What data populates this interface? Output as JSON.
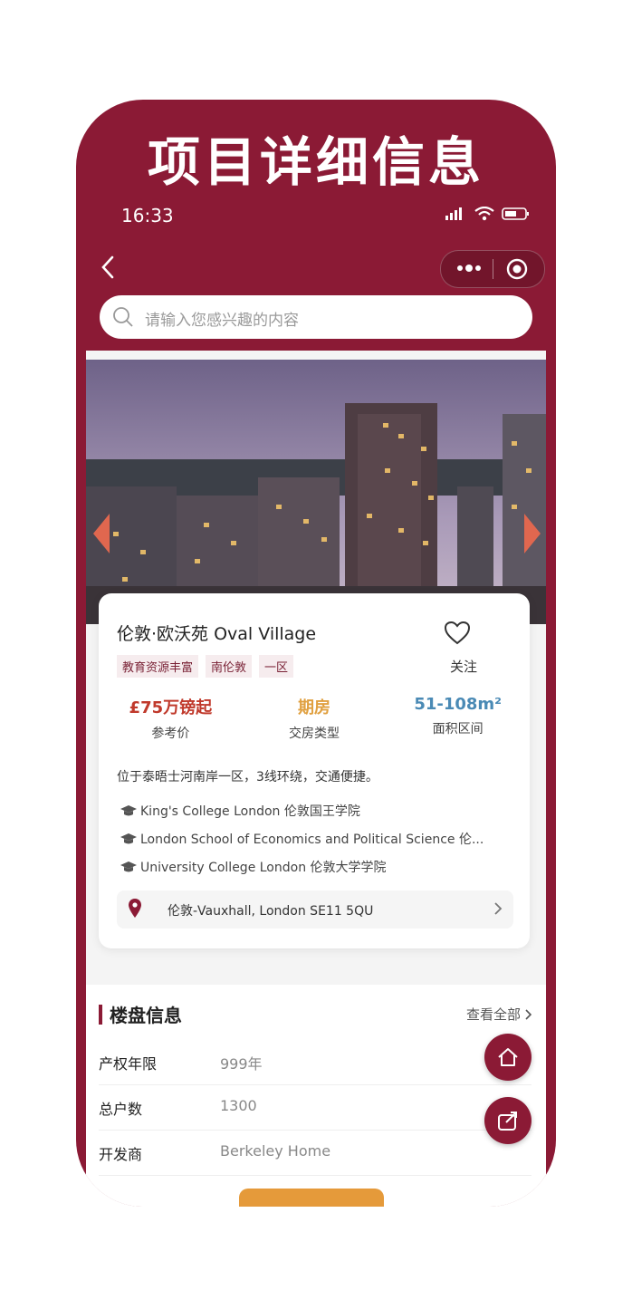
{
  "banner": {
    "title": "项目详细信息"
  },
  "status_bar": {
    "time": "16:33"
  },
  "search": {
    "placeholder": "请输入您感兴趣的内容"
  },
  "project": {
    "title": "伦敦·欧沃苑 Oval Village",
    "tags": [
      "教育资源丰富",
      "南伦敦",
      "一区"
    ],
    "favorite_label": "关注",
    "stats": [
      {
        "value": "£75万镑起",
        "label": "参考价",
        "color": "#c0392b"
      },
      {
        "value": "期房",
        "label": "交房类型",
        "color": "#e0a040"
      },
      {
        "value": "51-108m²",
        "label": "面积区间",
        "color": "#4a8ab5"
      }
    ],
    "description": "位于泰晤士河南岸一区，3线环绕，交通便捷。",
    "schools": [
      "King's College London 伦敦国王学院",
      "London School of Economics and Political Science 伦...",
      "University College London 伦敦大学学院"
    ],
    "address": "伦敦-Vauxhall, London SE11 5QU"
  },
  "building_info": {
    "title": "楼盘信息",
    "view_all": "查看全部",
    "rows": [
      {
        "key": "产权年限",
        "value": "999年"
      },
      {
        "key": "总户数",
        "value": "1300"
      },
      {
        "key": "开发商",
        "value": "Berkeley Home"
      }
    ]
  },
  "colors": {
    "brand": "#8b1a35",
    "accent": "#e59a3a"
  },
  "icons": [
    "back-icon",
    "more-icon",
    "target-icon",
    "search-icon",
    "heart-icon",
    "graduation-cap-icon",
    "location-pin-icon",
    "chevron-right-icon",
    "home-icon",
    "share-icon"
  ]
}
